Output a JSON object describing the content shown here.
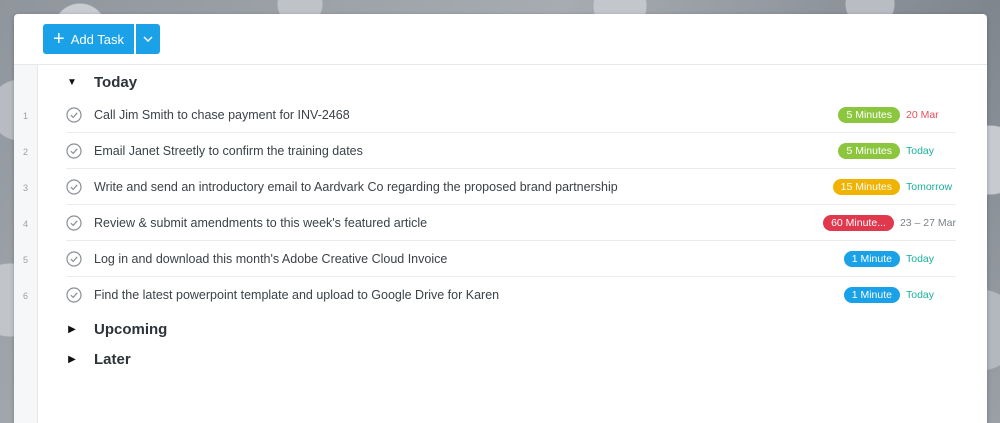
{
  "toolbar": {
    "add_task_label": "Add Task"
  },
  "sections": {
    "today": "Today",
    "upcoming": "Upcoming",
    "later": "Later"
  },
  "line_numbers": [
    "1",
    "2",
    "3",
    "4",
    "5",
    "6"
  ],
  "tasks": [
    {
      "title": "Call Jim Smith to chase payment for INV-2468",
      "estimate": "5 Minutes",
      "estimate_color": "#8cc63f",
      "due": "20 Mar",
      "due_color": "#e0505c"
    },
    {
      "title": "Email Janet Streetly to confirm the training dates",
      "estimate": "5 Minutes",
      "estimate_color": "#8cc63f",
      "due": "Today",
      "due_color": "#1aaf9a"
    },
    {
      "title": "Write and send an introductory email to Aardvark Co regarding the proposed brand partnership",
      "estimate": "15 Minutes",
      "estimate_color": "#f0b400",
      "due": "Tomorrow",
      "due_color": "#1aaf9a"
    },
    {
      "title": "Review & submit amendments to this week's featured article",
      "estimate": "60 Minute...",
      "estimate_color": "#e0394d",
      "due": "23 – 27 Mar",
      "due_color": "#7a8085"
    },
    {
      "title": "Log in and download this month's Adobe Creative Cloud Invoice",
      "estimate": "1 Minute",
      "estimate_color": "#1aa1e8",
      "due": "Today",
      "due_color": "#1aaf9a"
    },
    {
      "title": "Find the latest powerpoint template and upload to Google Drive for Karen",
      "estimate": "1 Minute",
      "estimate_color": "#1aa1e8",
      "due": "Today",
      "due_color": "#1aaf9a"
    }
  ],
  "colors": {
    "accent": "#1aa1e8"
  }
}
